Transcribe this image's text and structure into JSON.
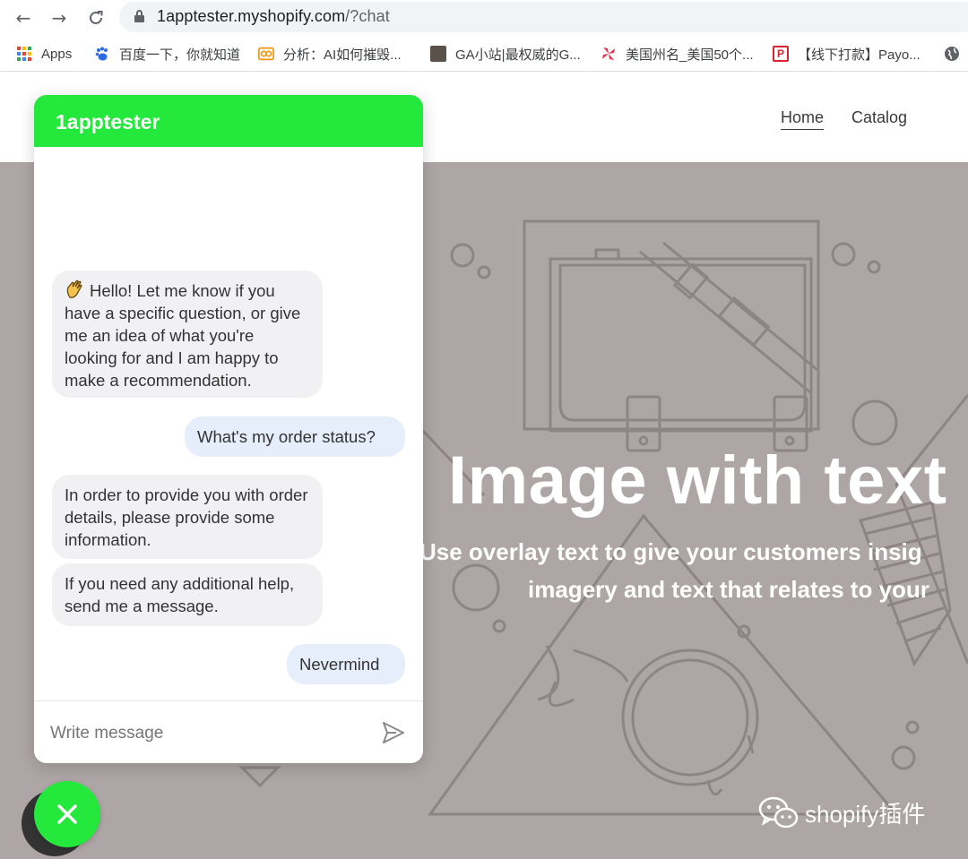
{
  "browser": {
    "url_host": "1apptester.myshopify.com",
    "url_path": "/?chat",
    "bookmarks": [
      {
        "label": "Apps",
        "icon": "apps-grid-icon"
      },
      {
        "label": "百度一下，你就知道",
        "icon": "baidu-paw-icon"
      },
      {
        "label": "分析：AI如何摧毁...",
        "icon": "analysis-icon"
      },
      {
        "label": "GA小站|最权威的G...",
        "icon": "ga-site-icon"
      },
      {
        "label": "美国州名_美国50个...",
        "icon": "pinwheel-icon"
      },
      {
        "label": "【线下打款】Payo...",
        "icon": "p-badge-icon"
      }
    ]
  },
  "store": {
    "nav": [
      {
        "label": "Home",
        "active": true
      },
      {
        "label": "Catalog",
        "active": false
      }
    ],
    "hero": {
      "title": "Image with text",
      "subtitle_line1": "Use overlay text to give your customers insig",
      "subtitle_line2": "imagery and text that relates to your"
    },
    "watermark": "shopify插件"
  },
  "chat": {
    "title": "1apptester",
    "messages": [
      {
        "from": "bot",
        "text": "Hello! Let me know if you have a specific question, or give me an idea of what you're looking for and I am happy to make a recommendation.",
        "emoji": "waving-hand-icon"
      },
      {
        "from": "user",
        "text": "What's my order status?"
      },
      {
        "from": "bot",
        "text": "In order to provide you with order details, please provide some information."
      },
      {
        "from": "bot",
        "text": "If you need any additional help, send me a message."
      },
      {
        "from": "user",
        "text": "Nevermind"
      }
    ],
    "composer_placeholder": "Write message"
  },
  "colors": {
    "chat_accent": "#25e83c",
    "hero_bg": "#aea6a6",
    "bot_bubble": "#f1f1f3",
    "user_bubble": "#e6eefb"
  }
}
